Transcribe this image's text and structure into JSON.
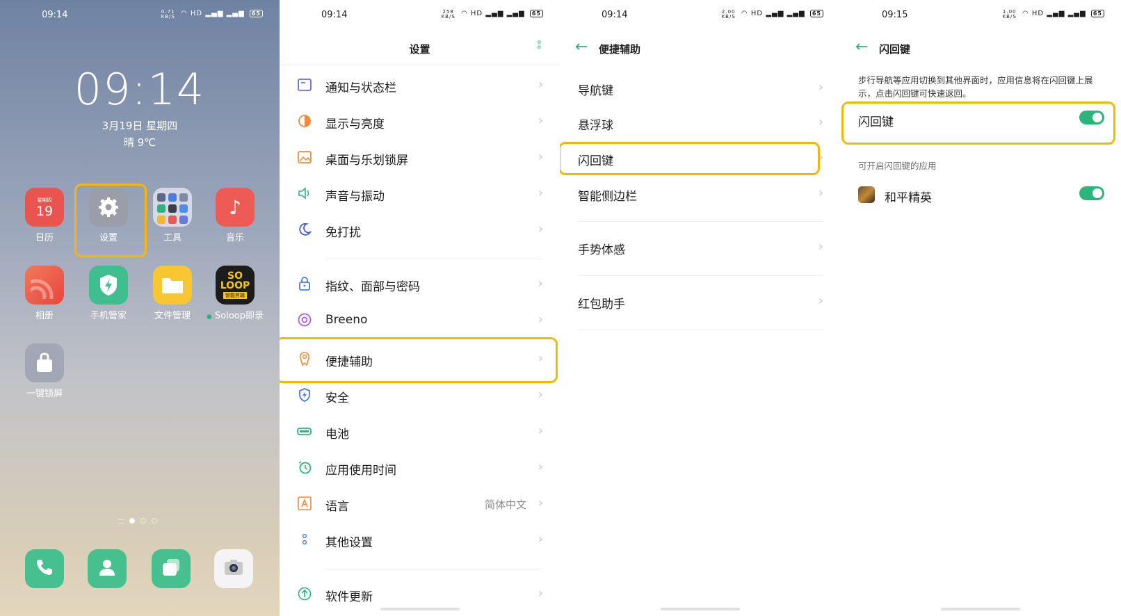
{
  "colors": {
    "accent": "#2db47d",
    "highlight": "#f5b800"
  },
  "home": {
    "status": {
      "time": "09:14",
      "net_speed": "0.71",
      "net_unit": "KB/S",
      "battery": "65",
      "signal": "HD"
    },
    "clock": "09:14",
    "date": "3月19日 星期四",
    "weather": "晴 9℃",
    "calendar_weekday": "星期四",
    "calendar_day": "19",
    "apps": {
      "calendar": "日历",
      "settings": "设置",
      "tools": "工具",
      "music": "音乐",
      "gallery": "相册",
      "phone_manager": "手机管家",
      "files": "文件管理",
      "soloop": "Soloop即录",
      "lock": "一键锁屏"
    },
    "soloop_logo_text": "SO LOOP",
    "soloop_logo_sub": "智能剪辑",
    "dock_icons": [
      "phone-icon",
      "contacts-icon",
      "multitask-icon",
      "camera-icon"
    ]
  },
  "settings": {
    "status": {
      "time": "09:14",
      "net_speed": "258",
      "net_unit": "KB/S",
      "battery": "65",
      "signal": "HD"
    },
    "title": "设置",
    "items": [
      {
        "label": "通知与状态栏",
        "icon": "notification-icon"
      },
      {
        "label": "显示与亮度",
        "icon": "brightness-icon"
      },
      {
        "label": "桌面与乐划锁屏",
        "icon": "wallpaper-icon"
      },
      {
        "label": "声音与振动",
        "icon": "speaker-icon"
      },
      {
        "label": "免打扰",
        "icon": "moon-icon"
      },
      {
        "label": "指纹、面部与密码",
        "icon": "lock-icon"
      },
      {
        "label": "Breeno",
        "icon": "breeno-icon"
      },
      {
        "label": "便捷辅助",
        "icon": "accessibility-icon"
      },
      {
        "label": "安全",
        "icon": "shield-icon"
      },
      {
        "label": "电池",
        "icon": "battery-icon"
      },
      {
        "label": "应用使用时间",
        "icon": "timer-icon"
      },
      {
        "label": "语言",
        "icon": "language-icon",
        "value": "简体中文"
      },
      {
        "label": "其他设置",
        "icon": "more-settings-icon"
      },
      {
        "label": "软件更新",
        "icon": "update-icon"
      }
    ]
  },
  "assist": {
    "status": {
      "time": "09:14",
      "net_speed": "2.00",
      "net_unit": "KB/S",
      "battery": "65",
      "signal": "HD"
    },
    "title": "便捷辅助",
    "items": [
      "导航键",
      "悬浮球",
      "闪回键",
      "智能侧边栏",
      "手势体感",
      "红包助手"
    ]
  },
  "flashback": {
    "status": {
      "time": "09:15",
      "net_speed": "1.00",
      "net_unit": "KB/S",
      "battery": "65",
      "signal": "HD"
    },
    "title": "闪回键",
    "description": "步行导航等应用切换到其他界面时，应用信息将在闪回键上展示，点击闪回键可快速返回。",
    "toggle_label": "闪回键",
    "toggle_on": true,
    "section_header": "可开启闪回键的应用",
    "apps": [
      {
        "name": "和平精英",
        "enabled": true
      }
    ]
  }
}
